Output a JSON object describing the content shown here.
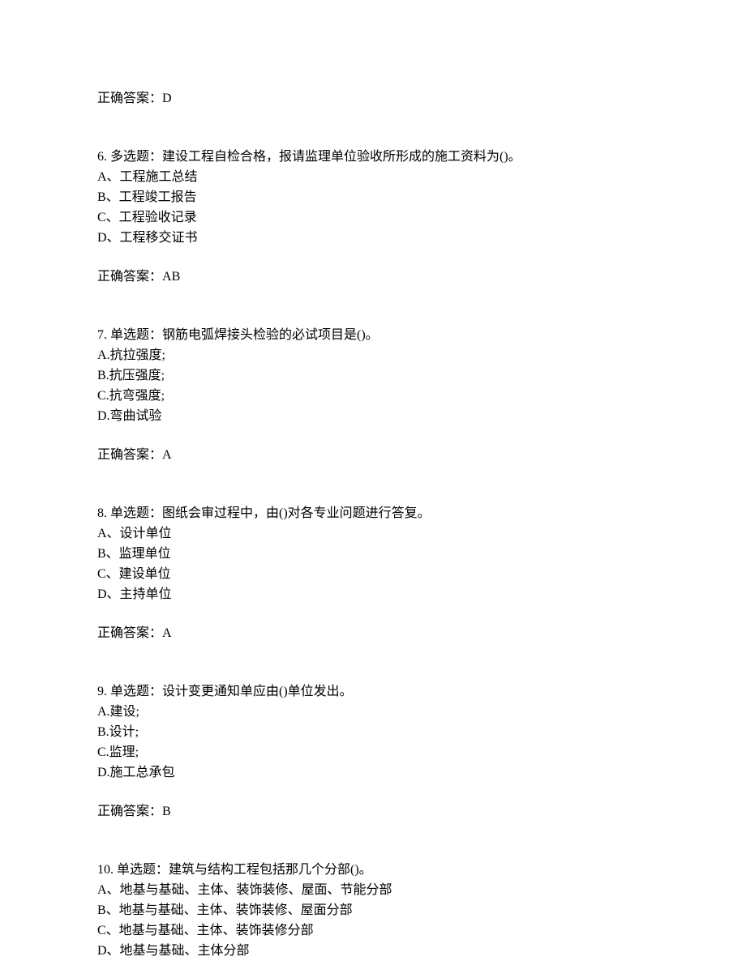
{
  "answer_top": {
    "label": "正确答案：",
    "value": "D"
  },
  "questions": [
    {
      "number": "6.",
      "type": "多选题：",
      "stem": "建设工程自检合格，报请监理单位验收所形成的施工资料为()。",
      "options": [
        "A、工程施工总结",
        "B、工程竣工报告",
        "C、工程验收记录",
        "D、工程移交证书"
      ],
      "answer_label": "正确答案：",
      "answer_value": "AB"
    },
    {
      "number": "7.",
      "type": "单选题：",
      "stem": "钢筋电弧焊接头检验的必试项目是()。",
      "options": [
        "A.抗拉强度;",
        "B.抗压强度;",
        "C.抗弯强度;",
        "D.弯曲试验"
      ],
      "answer_label": "正确答案：",
      "answer_value": "A"
    },
    {
      "number": "8.",
      "type": "单选题：",
      "stem": "图纸会审过程中，由()对各专业问题进行答复。",
      "options": [
        "A、设计单位",
        "B、监理单位",
        "C、建设单位",
        "D、主持单位"
      ],
      "answer_label": "正确答案：",
      "answer_value": "A"
    },
    {
      "number": "9.",
      "type": "单选题：",
      "stem": "设计变更通知单应由()单位发出。",
      "options": [
        "A.建设;",
        "B.设计;",
        "C.监理;",
        "D.施工总承包"
      ],
      "answer_label": "正确答案：",
      "answer_value": "B"
    },
    {
      "number": "10.",
      "type": "单选题：",
      "stem": "建筑与结构工程包括那几个分部()。",
      "options": [
        "A、地基与基础、主体、装饰装修、屋面、节能分部",
        "B、地基与基础、主体、装饰装修、屋面分部",
        "C、地基与基础、主体、装饰装修分部",
        "D、地基与基础、主体分部"
      ],
      "answer_label": "",
      "answer_value": ""
    }
  ]
}
